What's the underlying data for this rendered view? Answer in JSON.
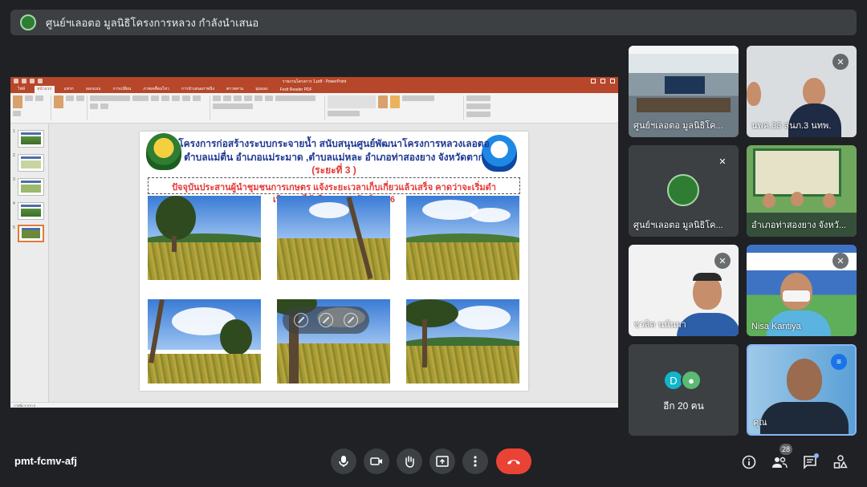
{
  "banner": {
    "title": "ศูนย์ฯเลอตอ มูลนิธิโครงการหลวง กำลังนำเสนอ"
  },
  "powerpoint": {
    "window_title": "รายงานโครงการ 1.pdf - PowerPoint",
    "tabs": [
      "ไฟล์",
      "หน้าแรก",
      "แทรก",
      "ออกแบบ",
      "การเปลี่ยน",
      "ภาพเคลื่อนไหว",
      "การนำเสนอภาพนิ่ง",
      "ตรวจทาน",
      "มุมมอง",
      "Foxit Reader PDF"
    ],
    "active_tab": "หน้าแรก",
    "slide_numbers": [
      "1",
      "2",
      "3",
      "4",
      "5"
    ],
    "status_text": "ภาพนิ่ง 5 จาก 5"
  },
  "slide": {
    "title_line1": "โครงการก่อสร้างระบบกระจายน้ำ สนับสนุนศูนย์พัฒนาโครงการหลวงเลอตอ",
    "title_line2": "ตำบลแม่ตื่น อำเภอแม่ระมาด ,ตำบลแม่หละ อำเภอท่าสองยาง จังหวัดตาก",
    "phase": "(ระยะที่ 3 )",
    "note_line1": "ปัจจุบันประสานผู้นำชุมชนการเกษตร แจ้งระยะเวลาเก็บเกี่ยวแล้วเสร็จ คาดว่าจะเริ่มดำ",
    "note_line2": "เนินงานได้เดือนกุมภาพันธ์ 2566"
  },
  "participants": [
    {
      "name": "ศูนย์ฯเลอตอ มูลนิธิโค...",
      "muted": false
    },
    {
      "name": "นพค.33 สนภ.3 นทพ.",
      "muted": true
    },
    {
      "name": "ศูนย์ฯเลอตอ มูลนิธิโค...",
      "muted": true
    },
    {
      "name": "อำเภอท่าสองยาง จังหวั...",
      "muted": false
    },
    {
      "name": "ชวลิต นนันผา",
      "muted": true
    },
    {
      "name": "Nisa Kantiya",
      "muted": true
    },
    {
      "name": "คุณ",
      "muted": false
    }
  ],
  "more_tile": {
    "initial": "D",
    "label": "อีก 20 คน"
  },
  "meeting": {
    "code": "pmt-fcmv-afj",
    "people_count": "28"
  },
  "icons": {
    "mic": "mic-icon",
    "camera": "camera-icon",
    "hand": "raise-hand-icon",
    "present": "present-screen-icon",
    "more": "more-vert-icon",
    "end": "end-call-icon",
    "info": "info-icon",
    "people": "people-icon",
    "chat": "chat-icon",
    "activities": "activities-icon"
  },
  "colors": {
    "end_call": "#ea4335",
    "active_speaker": "#8ab4f8",
    "ppt_brand": "#b7472a"
  }
}
